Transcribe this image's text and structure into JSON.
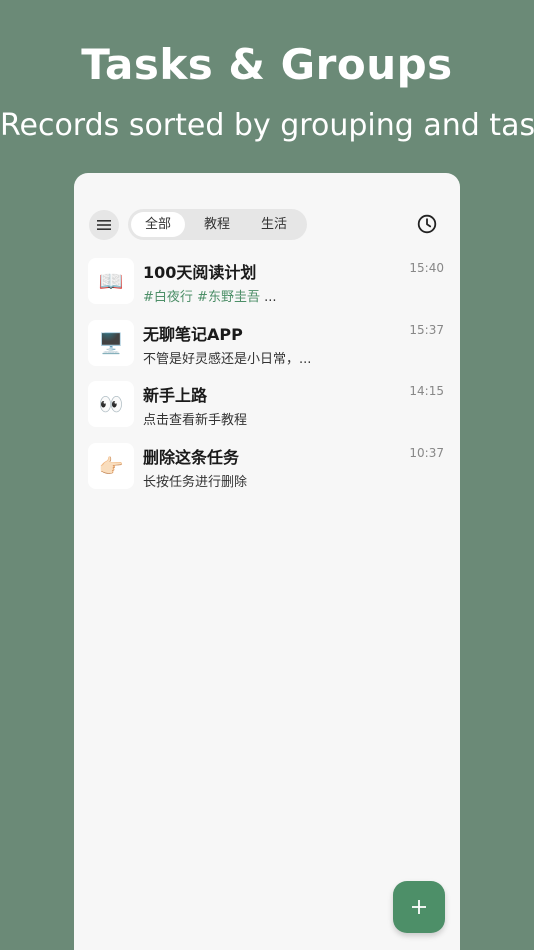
{
  "hero": {
    "title": "Tasks & Groups",
    "subtitle": "Records sorted by grouping and task"
  },
  "header": {
    "menu_icon": "hamburger-menu-icon",
    "history_icon": "clock-icon",
    "tabs": [
      {
        "label": "全部",
        "active": true
      },
      {
        "label": "教程",
        "active": false
      },
      {
        "label": "生活",
        "active": false
      }
    ]
  },
  "tasks": [
    {
      "icon": "📖",
      "title": "100天阅读计划",
      "tags": [
        "#白夜行",
        "#东野圭吾"
      ],
      "subtitle_suffix": " ...",
      "time": "15:40"
    },
    {
      "icon": "🖥️",
      "title": "无聊笔记APP",
      "subtitle": "不管是好灵感还是小日常，...",
      "time": "15:37"
    },
    {
      "icon": "👀",
      "title": "新手上路",
      "subtitle": "点击查看新手教程",
      "time": "14:15"
    },
    {
      "icon": "👉🏻",
      "title": "删除这条任务",
      "subtitle": "长按任务进行删除",
      "time": "10:37"
    }
  ],
  "fab": {
    "icon": "plus-icon",
    "label": "+"
  },
  "colors": {
    "background": "#6b8a77",
    "accent": "#4d8f68",
    "card": "#f7f7f7"
  }
}
